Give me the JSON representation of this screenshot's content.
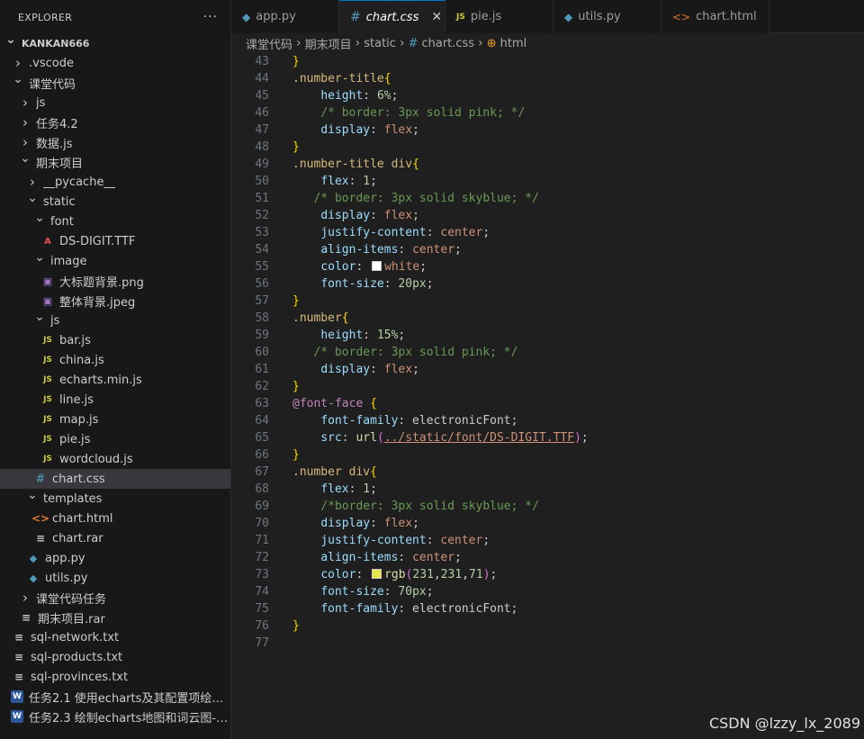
{
  "explorer": {
    "title": "EXPLORER",
    "more": "···",
    "items": [
      {
        "label": "KANKAN666",
        "depth": 0,
        "chev": "v",
        "icon": "",
        "root": true
      },
      {
        "label": ".vscode",
        "depth": 1,
        "chev": ">",
        "icon": ""
      },
      {
        "label": "课堂代码",
        "depth": 1,
        "chev": "v",
        "icon": ""
      },
      {
        "label": "js",
        "depth": 2,
        "chev": ">",
        "icon": ""
      },
      {
        "label": "任务4.2",
        "depth": 2,
        "chev": ">",
        "icon": ""
      },
      {
        "label": "数据.js",
        "depth": 2,
        "chev": ">",
        "icon": ""
      },
      {
        "label": "期末项目",
        "depth": 2,
        "chev": "v",
        "icon": ""
      },
      {
        "label": "__pycache__",
        "depth": 3,
        "chev": ">",
        "icon": ""
      },
      {
        "label": "static",
        "depth": 3,
        "chev": "v",
        "icon": ""
      },
      {
        "label": "font",
        "depth": 4,
        "chev": "v",
        "icon": ""
      },
      {
        "label": "DS-DIGIT.TTF",
        "depth": 5,
        "chev": "",
        "icon": "font"
      },
      {
        "label": "image",
        "depth": 4,
        "chev": "v",
        "icon": ""
      },
      {
        "label": "大标题背景.png",
        "depth": 5,
        "chev": "",
        "icon": "img"
      },
      {
        "label": "整体背景.jpeg",
        "depth": 5,
        "chev": "",
        "icon": "img"
      },
      {
        "label": "js",
        "depth": 4,
        "chev": "v",
        "icon": ""
      },
      {
        "label": "bar.js",
        "depth": 5,
        "chev": "",
        "icon": "js"
      },
      {
        "label": "china.js",
        "depth": 5,
        "chev": "",
        "icon": "js"
      },
      {
        "label": "echarts.min.js",
        "depth": 5,
        "chev": "",
        "icon": "js"
      },
      {
        "label": "line.js",
        "depth": 5,
        "chev": "",
        "icon": "js"
      },
      {
        "label": "map.js",
        "depth": 5,
        "chev": "",
        "icon": "js"
      },
      {
        "label": "pie.js",
        "depth": 5,
        "chev": "",
        "icon": "js"
      },
      {
        "label": "wordcloud.js",
        "depth": 5,
        "chev": "",
        "icon": "js"
      },
      {
        "label": "chart.css",
        "depth": 4,
        "chev": "",
        "icon": "css",
        "selected": true
      },
      {
        "label": "templates",
        "depth": 3,
        "chev": "v",
        "icon": ""
      },
      {
        "label": "chart.html",
        "depth": 4,
        "chev": "",
        "icon": "html"
      },
      {
        "label": "chart.rar",
        "depth": 4,
        "chev": "",
        "icon": "txt"
      },
      {
        "label": "app.py",
        "depth": 3,
        "chev": "",
        "icon": "py"
      },
      {
        "label": "utils.py",
        "depth": 3,
        "chev": "",
        "icon": "py"
      },
      {
        "label": "课堂代码任务",
        "depth": 2,
        "chev": ">",
        "icon": ""
      },
      {
        "label": "期末项目.rar",
        "depth": 2,
        "chev": "",
        "icon": "txt"
      },
      {
        "label": "sql-network.txt",
        "depth": 1,
        "chev": "",
        "icon": "txt"
      },
      {
        "label": "sql-products.txt",
        "depth": 1,
        "chev": "",
        "icon": "txt"
      },
      {
        "label": "sql-provinces.txt",
        "depth": 1,
        "chev": "",
        "icon": "txt"
      },
      {
        "label": "任务2.1 使用echarts及其配置项绘图-...",
        "depth": 1,
        "chev": "",
        "icon": "doc"
      },
      {
        "label": "任务2.3 绘制echarts地图和词云图-学...",
        "depth": 1,
        "chev": "",
        "icon": "doc"
      }
    ]
  },
  "tabs": [
    {
      "label": "app.py",
      "icon": "py",
      "active": false,
      "width": 120
    },
    {
      "label": "chart.css",
      "icon": "css",
      "active": true,
      "width": 118
    },
    {
      "label": "pie.js",
      "icon": "js",
      "active": false,
      "width": 120
    },
    {
      "label": "utils.py",
      "icon": "py",
      "active": false,
      "width": 120
    },
    {
      "label": "chart.html",
      "icon": "html",
      "active": false,
      "width": 120
    }
  ],
  "breadcrumb": [
    "课堂代码",
    "期末项目",
    "static",
    "chart.css",
    "html"
  ],
  "code": [
    {
      "n": "43",
      "t": [
        [
          "brace",
          "}"
        ]
      ]
    },
    {
      "n": "44",
      "t": [
        [
          "sel",
          ".number-title"
        ],
        [
          "brace",
          "{"
        ]
      ]
    },
    {
      "n": "45",
      "t": [
        [
          "plain",
          "    "
        ],
        [
          "prop",
          "height"
        ],
        [
          "plain",
          ": "
        ],
        [
          "num",
          "6%"
        ],
        [
          "plain",
          ";"
        ]
      ]
    },
    {
      "n": "46",
      "t": [
        [
          "plain",
          "    "
        ],
        [
          "cmt",
          "/* border: 3px solid pink; */"
        ]
      ]
    },
    {
      "n": "47",
      "t": [
        [
          "plain",
          "    "
        ],
        [
          "prop",
          "display"
        ],
        [
          "plain",
          ": "
        ],
        [
          "kw",
          "flex"
        ],
        [
          "plain",
          ";"
        ]
      ]
    },
    {
      "n": "48",
      "t": [
        [
          "brace",
          "}"
        ]
      ]
    },
    {
      "n": "49",
      "t": [
        [
          "sel",
          ".number-title div"
        ],
        [
          "brace",
          "{"
        ]
      ]
    },
    {
      "n": "50",
      "t": [
        [
          "plain",
          "    "
        ],
        [
          "prop",
          "flex"
        ],
        [
          "plain",
          ": "
        ],
        [
          "num",
          "1"
        ],
        [
          "plain",
          ";"
        ]
      ]
    },
    {
      "n": "51",
      "t": [
        [
          "plain",
          "   "
        ],
        [
          "cmt",
          "/* border: 3px solid skyblue; */"
        ]
      ]
    },
    {
      "n": "52",
      "t": [
        [
          "plain",
          "    "
        ],
        [
          "prop",
          "display"
        ],
        [
          "plain",
          ": "
        ],
        [
          "kw",
          "flex"
        ],
        [
          "plain",
          ";"
        ]
      ]
    },
    {
      "n": "53",
      "t": [
        [
          "plain",
          "    "
        ],
        [
          "prop",
          "justify-content"
        ],
        [
          "plain",
          ": "
        ],
        [
          "kw",
          "center"
        ],
        [
          "plain",
          ";"
        ]
      ]
    },
    {
      "n": "54",
      "t": [
        [
          "plain",
          "    "
        ],
        [
          "prop",
          "align-items"
        ],
        [
          "plain",
          ": "
        ],
        [
          "kw",
          "center"
        ],
        [
          "plain",
          ";"
        ]
      ]
    },
    {
      "n": "55",
      "t": [
        [
          "plain",
          "    "
        ],
        [
          "prop",
          "color"
        ],
        [
          "plain",
          ": "
        ],
        [
          "swatch",
          "#ffffff"
        ],
        [
          "kw",
          "white"
        ],
        [
          "plain",
          ";"
        ]
      ]
    },
    {
      "n": "56",
      "t": [
        [
          "plain",
          "    "
        ],
        [
          "prop",
          "font-size"
        ],
        [
          "plain",
          ": "
        ],
        [
          "num",
          "20px"
        ],
        [
          "plain",
          ";"
        ]
      ]
    },
    {
      "n": "57",
      "t": [
        [
          "brace",
          "}"
        ]
      ]
    },
    {
      "n": "58",
      "t": [
        [
          "sel",
          ".number"
        ],
        [
          "brace",
          "{"
        ]
      ]
    },
    {
      "n": "59",
      "t": [
        [
          "plain",
          "    "
        ],
        [
          "prop",
          "height"
        ],
        [
          "plain",
          ": "
        ],
        [
          "num",
          "15%"
        ],
        [
          "plain",
          ";"
        ]
      ]
    },
    {
      "n": "60",
      "t": [
        [
          "plain",
          "   "
        ],
        [
          "cmt",
          "/* border: 3px solid pink; */"
        ]
      ]
    },
    {
      "n": "61",
      "t": [
        [
          "plain",
          "    "
        ],
        [
          "prop",
          "display"
        ],
        [
          "plain",
          ": "
        ],
        [
          "kw",
          "flex"
        ],
        [
          "plain",
          ";"
        ]
      ]
    },
    {
      "n": "62",
      "t": [
        [
          "brace",
          "}"
        ]
      ]
    },
    {
      "n": "63",
      "t": [
        [
          "at",
          "@font-face"
        ],
        [
          "plain",
          " "
        ],
        [
          "brace",
          "{"
        ]
      ]
    },
    {
      "n": "64",
      "t": [
        [
          "plain",
          "    "
        ],
        [
          "prop",
          "font-family"
        ],
        [
          "plain",
          ": electronicFont;"
        ]
      ]
    },
    {
      "n": "65",
      "t": [
        [
          "plain",
          "    "
        ],
        [
          "prop",
          "src"
        ],
        [
          "plain",
          ": "
        ],
        [
          "fn",
          "url"
        ],
        [
          "paren",
          "("
        ],
        [
          "url",
          "../static/font/DS-DIGIT.TTF"
        ],
        [
          "paren",
          ")"
        ],
        [
          "plain",
          ";"
        ]
      ]
    },
    {
      "n": "66",
      "t": [
        [
          "brace",
          "}"
        ]
      ]
    },
    {
      "n": "67",
      "t": [
        [
          "sel",
          ".number div"
        ],
        [
          "brace",
          "{"
        ]
      ]
    },
    {
      "n": "68",
      "t": [
        [
          "plain",
          "    "
        ],
        [
          "prop",
          "flex"
        ],
        [
          "plain",
          ": "
        ],
        [
          "num",
          "1"
        ],
        [
          "plain",
          ";"
        ]
      ]
    },
    {
      "n": "69",
      "t": [
        [
          "plain",
          "    "
        ],
        [
          "cmt",
          "/*border: 3px solid skyblue; */"
        ]
      ]
    },
    {
      "n": "70",
      "t": [
        [
          "plain",
          "    "
        ],
        [
          "prop",
          "display"
        ],
        [
          "plain",
          ": "
        ],
        [
          "kw",
          "flex"
        ],
        [
          "plain",
          ";"
        ]
      ]
    },
    {
      "n": "71",
      "t": [
        [
          "plain",
          "    "
        ],
        [
          "prop",
          "justify-content"
        ],
        [
          "plain",
          ": "
        ],
        [
          "kw",
          "center"
        ],
        [
          "plain",
          ";"
        ]
      ]
    },
    {
      "n": "72",
      "t": [
        [
          "plain",
          "    "
        ],
        [
          "prop",
          "align-items"
        ],
        [
          "plain",
          ": "
        ],
        [
          "kw",
          "center"
        ],
        [
          "plain",
          ";"
        ]
      ]
    },
    {
      "n": "73",
      "t": [
        [
          "plain",
          "    "
        ],
        [
          "prop",
          "color"
        ],
        [
          "plain",
          ": "
        ],
        [
          "swatch",
          "#e7e747"
        ],
        [
          "fn",
          "rgb"
        ],
        [
          "paren",
          "("
        ],
        [
          "num",
          "231"
        ],
        [
          "plain",
          ","
        ],
        [
          "num",
          "231"
        ],
        [
          "plain",
          ","
        ],
        [
          "num",
          "71"
        ],
        [
          "paren",
          ")"
        ],
        [
          "plain",
          ";"
        ]
      ]
    },
    {
      "n": "74",
      "t": [
        [
          "plain",
          "    "
        ],
        [
          "prop",
          "font-size"
        ],
        [
          "plain",
          ": "
        ],
        [
          "num",
          "70px"
        ],
        [
          "plain",
          ";"
        ]
      ]
    },
    {
      "n": "75",
      "t": [
        [
          "plain",
          "    "
        ],
        [
          "prop",
          "font-family"
        ],
        [
          "plain",
          ": electronicFont;"
        ]
      ]
    },
    {
      "n": "76",
      "t": [
        [
          "brace",
          "}"
        ]
      ]
    },
    {
      "n": "77",
      "t": []
    }
  ],
  "watermark": "CSDN @lzzy_lx_2089"
}
